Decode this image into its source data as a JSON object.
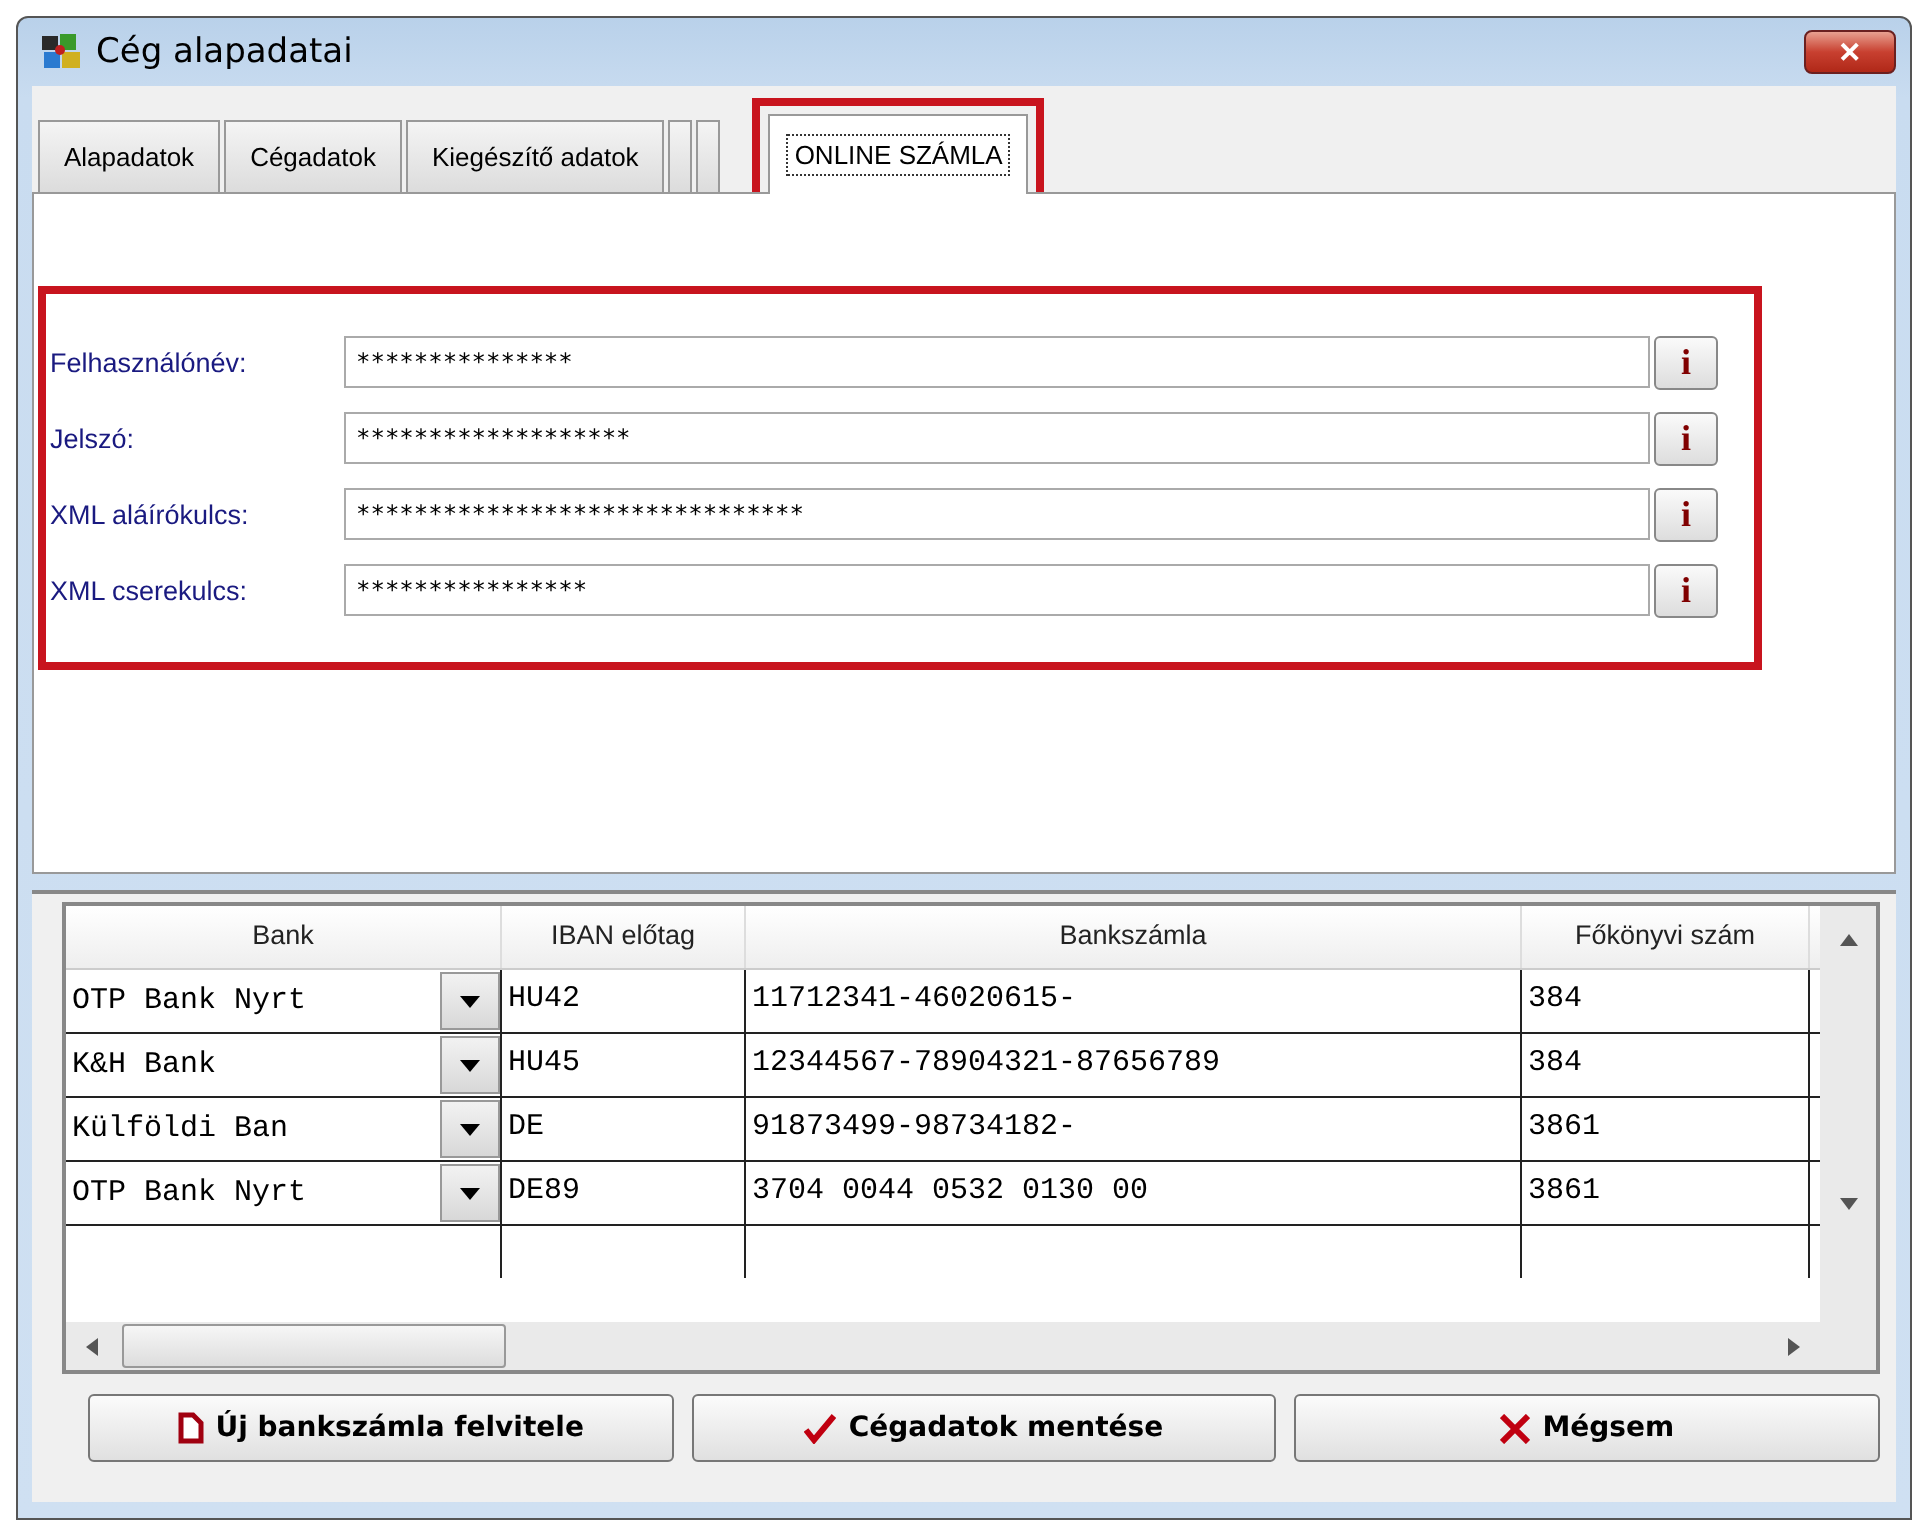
{
  "window": {
    "title": "Cég alapadatai",
    "close_glyph": "✕"
  },
  "tabs": [
    {
      "label": "Alapadatok",
      "selected": false
    },
    {
      "label": "Cégadatok",
      "selected": false
    },
    {
      "label": "Kiegészítő adatok",
      "selected": false
    },
    {
      "kind": "blank",
      "selected": false
    },
    {
      "kind": "blank",
      "selected": false
    },
    {
      "label": "ONLINE SZÁMLA",
      "selected": true,
      "highlighted": true
    }
  ],
  "credentials": {
    "highlighted": true,
    "fields": [
      {
        "label": "Felhasználónév:",
        "value": "***************",
        "info_glyph": "i"
      },
      {
        "label": "Jelszó:",
        "value": "*******************",
        "info_glyph": "i"
      },
      {
        "label": "XML aláírókulcs:",
        "value": "*******************************",
        "info_glyph": "i"
      },
      {
        "label": "XML cserekulcs:",
        "value": "****************",
        "info_glyph": "i"
      }
    ]
  },
  "table": {
    "columns": [
      "Bank",
      "IBAN előtag",
      "Bankszámla",
      "Főkönyvi szám"
    ],
    "rows": [
      {
        "bank": "OTP Bank Nyrt",
        "iban": "HU42",
        "account": "11712341-46020615-",
        "ledger": "384"
      },
      {
        "bank": "K&H Bank",
        "iban": "HU45",
        "account": "12344567-78904321-87656789",
        "ledger": "384"
      },
      {
        "bank": "Külföldi Ban",
        "iban": "DE",
        "account": "91873499-98734182-",
        "ledger": "3861"
      },
      {
        "bank": "OTP Bank Nyrt",
        "iban": "DE89",
        "account": "3704 0044 0532 0130 00",
        "ledger": "3861"
      }
    ]
  },
  "buttons": [
    {
      "label": "Új bankszámla felvitele",
      "kind": "new"
    },
    {
      "label": "Cégadatok mentése",
      "kind": "save"
    },
    {
      "label": "Mégsem",
      "kind": "cancel"
    }
  ]
}
